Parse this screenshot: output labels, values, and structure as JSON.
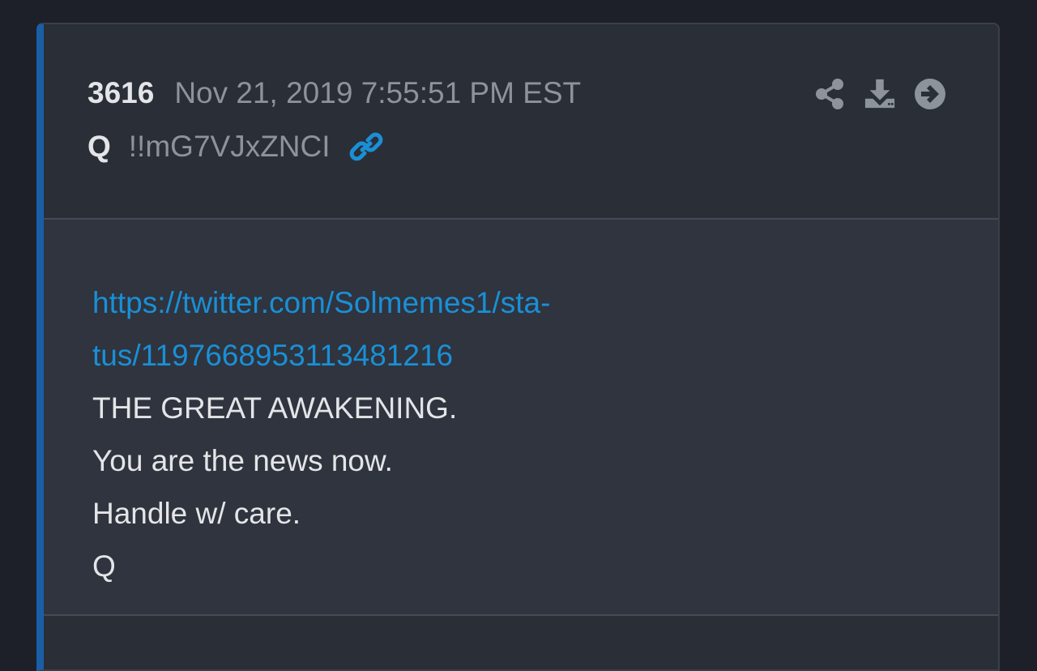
{
  "post": {
    "number": "3616",
    "date": "Nov 21, 2019 7:55:51 PM EST",
    "author": "Q",
    "tripcode": "!!mG7VJxZNCI",
    "body": {
      "link_line_1": "https://twitter.com/Solmemes1/sta-",
      "link_line_2": "tus/1197668953113481216",
      "lines": [
        "THE GREAT AWAKENING.",
        "You are the news now.",
        "Handle w/ care.",
        "Q"
      ]
    }
  },
  "icons": {
    "share": "share-icon",
    "download": "download-icon",
    "next": "arrow-right-circle-icon",
    "link": "link-icon"
  },
  "colors": {
    "page_background": "#1d2028",
    "card_background": "#2a2e36",
    "body_background": "#2f343e",
    "accent_border": "#1a5ea6",
    "link": "#1a8fd6",
    "muted_text": "#8d939c",
    "primary_text": "#e3e5e8",
    "icon": "#8d939c"
  }
}
